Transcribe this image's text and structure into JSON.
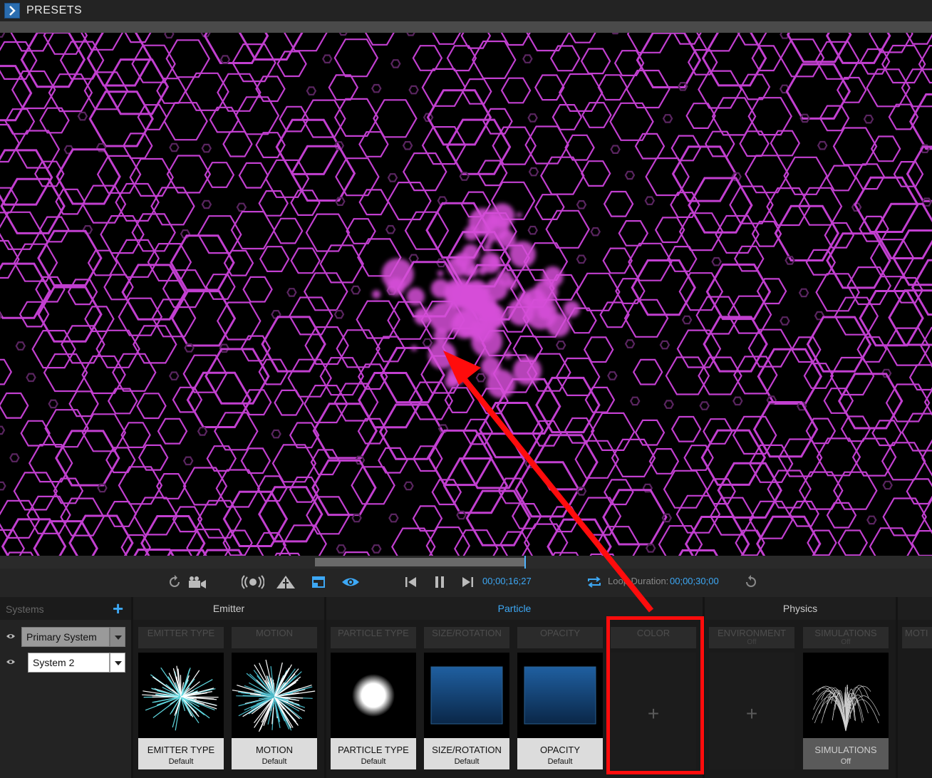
{
  "header": {
    "title": "PRESETS"
  },
  "transport": {
    "timecode": "00;00;16;27",
    "loop_label": "Loop Duration:",
    "duration": "00;00;30;00",
    "playhead_fraction": 0.56
  },
  "systems": {
    "header": "Systems",
    "items": [
      {
        "label": "Primary System",
        "selected": true
      },
      {
        "label": "System 2",
        "selected": false
      }
    ]
  },
  "sections": {
    "emitter": "Emitter",
    "particle": "Particle",
    "physics": "Physics"
  },
  "slots": {
    "emitter_type": {
      "tab": "EMITTER TYPE",
      "label": "EMITTER TYPE",
      "value": "Default"
    },
    "motion": {
      "tab": "MOTION",
      "label": "MOTION",
      "value": "Default"
    },
    "particle_type": {
      "tab": "PARTICLE TYPE",
      "label": "PARTICLE TYPE",
      "value": "Default"
    },
    "size_rotation": {
      "tab": "SIZE/ROTATION",
      "label": "SIZE/ROTATION",
      "value": "Default"
    },
    "opacity": {
      "tab": "OPACITY",
      "label": "OPACITY",
      "value": "Default"
    },
    "color": {
      "tab": "COLOR"
    },
    "environment": {
      "tab": "ENVIRONMENT",
      "sub": "Off"
    },
    "simulations": {
      "tab": "SIMULATIONS",
      "sub": "Off",
      "label": "SIMULATIONS",
      "value": "Off"
    },
    "motion2": {
      "tab": "MOTI"
    }
  },
  "colors": {
    "accent": "#3da8f5",
    "hex": "#c23fd0",
    "annotation": "#ff0c0c"
  }
}
